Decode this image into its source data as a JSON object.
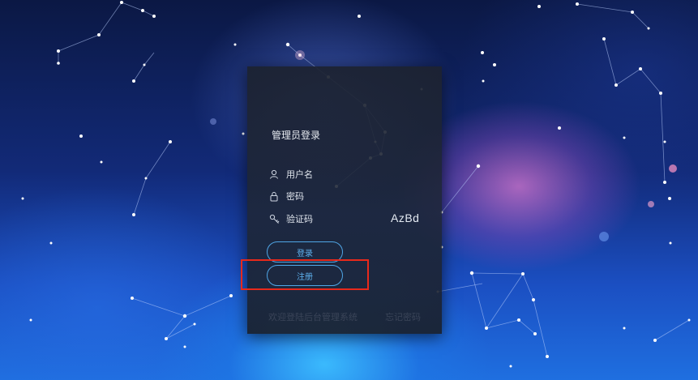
{
  "login": {
    "title": "管理员登录",
    "username_label": "用户名",
    "password_label": "密码",
    "captcha_label": "验证码",
    "captcha_value": "AzBd",
    "login_button": "登录",
    "register_button": "注册",
    "welcome_text": "欢迎登陆后台管理系统",
    "forgot_password": "忘记密码"
  },
  "colors": {
    "accent": "#4fa6e6",
    "highlight_box": "#e8291b"
  }
}
